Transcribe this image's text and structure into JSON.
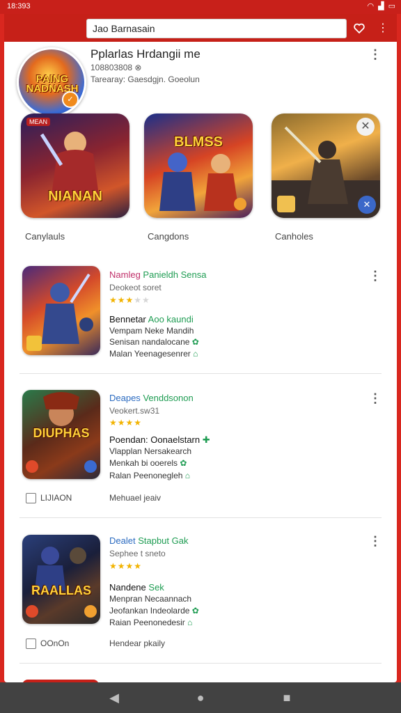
{
  "status": {
    "time": "18:393"
  },
  "search": {
    "value": "Jao Barnasain"
  },
  "app": {
    "logo_text": "PAING NADNASH",
    "title": "Pplarlas Hrdangii me",
    "subtitle": "108803808 ⊗",
    "tagline": "Tarearay: Gaesdgjn. Goeolun"
  },
  "features": [
    {
      "label": "Canylauls",
      "art_text": "NIANAN",
      "tag": "MEAN"
    },
    {
      "label": "Cangdons",
      "art_text": "BLMSS"
    },
    {
      "label": "Canholes"
    }
  ],
  "items": [
    {
      "title_a": "Namleg",
      "title_b": "Panieldh Sensa",
      "developer": "Deokeot soret",
      "rating": 3,
      "line1_a": "Bennetar",
      "line1_b": "Aoo kaundi",
      "line2": "Vempam Neke Mandih",
      "line3": "Senisan nandalocane",
      "line4": "Malan Yeenagesenrer",
      "thumb_text": ""
    },
    {
      "title_a": "Deapes",
      "title_b": "Venddsonon",
      "developer": "Veokert.sw31",
      "rating": 4,
      "line1_a": "Poendan:",
      "line1_b": "Oonaelstarn",
      "line2": "Vlapplan Nersakearch",
      "line3": "Menkah bi ooerels",
      "line4": "Ralan Peenonegleh",
      "thumb_text": "DIUPHAS",
      "check_label": "LIJIAON",
      "check_right": "Mehuael jeaiv"
    },
    {
      "title_a": "Dealet",
      "title_b": "Stapbut Gak",
      "developer": "Sephee t sneto",
      "rating": 4,
      "line1_a": "Nandene",
      "line1_b": "Sek",
      "line2": "Menpran Necaannach",
      "line3": "Jeofankan Indeolarde",
      "line4": "Raian Peenonedesir",
      "thumb_text": "RAALLAS",
      "check_label": "OOnOn",
      "check_right": "Hendear pkaily"
    }
  ],
  "colors": {
    "accent": "#c62018",
    "star": "#f2b300",
    "green": "#1e9c52"
  }
}
